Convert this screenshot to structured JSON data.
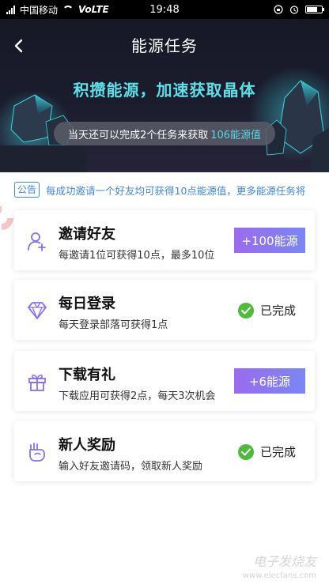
{
  "status_bar": {
    "carrier": "中国移动",
    "network": "VoLTE",
    "time": "19:48"
  },
  "header": {
    "title": "能源任务",
    "back_icon": "chevron-left-icon"
  },
  "hero": {
    "slogan": "积攒能源，加速获取晶体",
    "info_prefix": "当天还可以完成2个任务来获取",
    "info_highlight": "106能源值"
  },
  "notice": {
    "tag": "公告",
    "text": "每成功邀请一个好友均可获得10点能源值，更多能源任务将"
  },
  "tasks": [
    {
      "title": "邀请好友",
      "desc": "每邀请1位可获得10点，最多10位",
      "icon": "add-user-icon",
      "reward": "+100能源",
      "status": "reward"
    },
    {
      "title": "每日登录",
      "desc": "每天登录部落可获得1点",
      "icon": "diamond-icon",
      "done_label": "已完成",
      "status": "done"
    },
    {
      "title": "下载有礼",
      "desc": "下载应用可获得2点，每天3次机会",
      "icon": "gift-icon",
      "reward": "+6能源",
      "status": "reward"
    },
    {
      "title": "新人奖励",
      "desc": "输入好友邀请码，领取新人奖励",
      "icon": "handshake-icon",
      "done_label": "已完成",
      "status": "done"
    }
  ],
  "watermark": {
    "line1": "电子发烧友",
    "line2": "www.elecfans.com"
  },
  "colors": {
    "accent_blue": "#3d87e6",
    "reward_gradient_start": "#9b6bf0",
    "reward_gradient_end": "#7a86f3",
    "done_green": "#4fba3c",
    "slogan_cyan": "#5ce0e6"
  }
}
